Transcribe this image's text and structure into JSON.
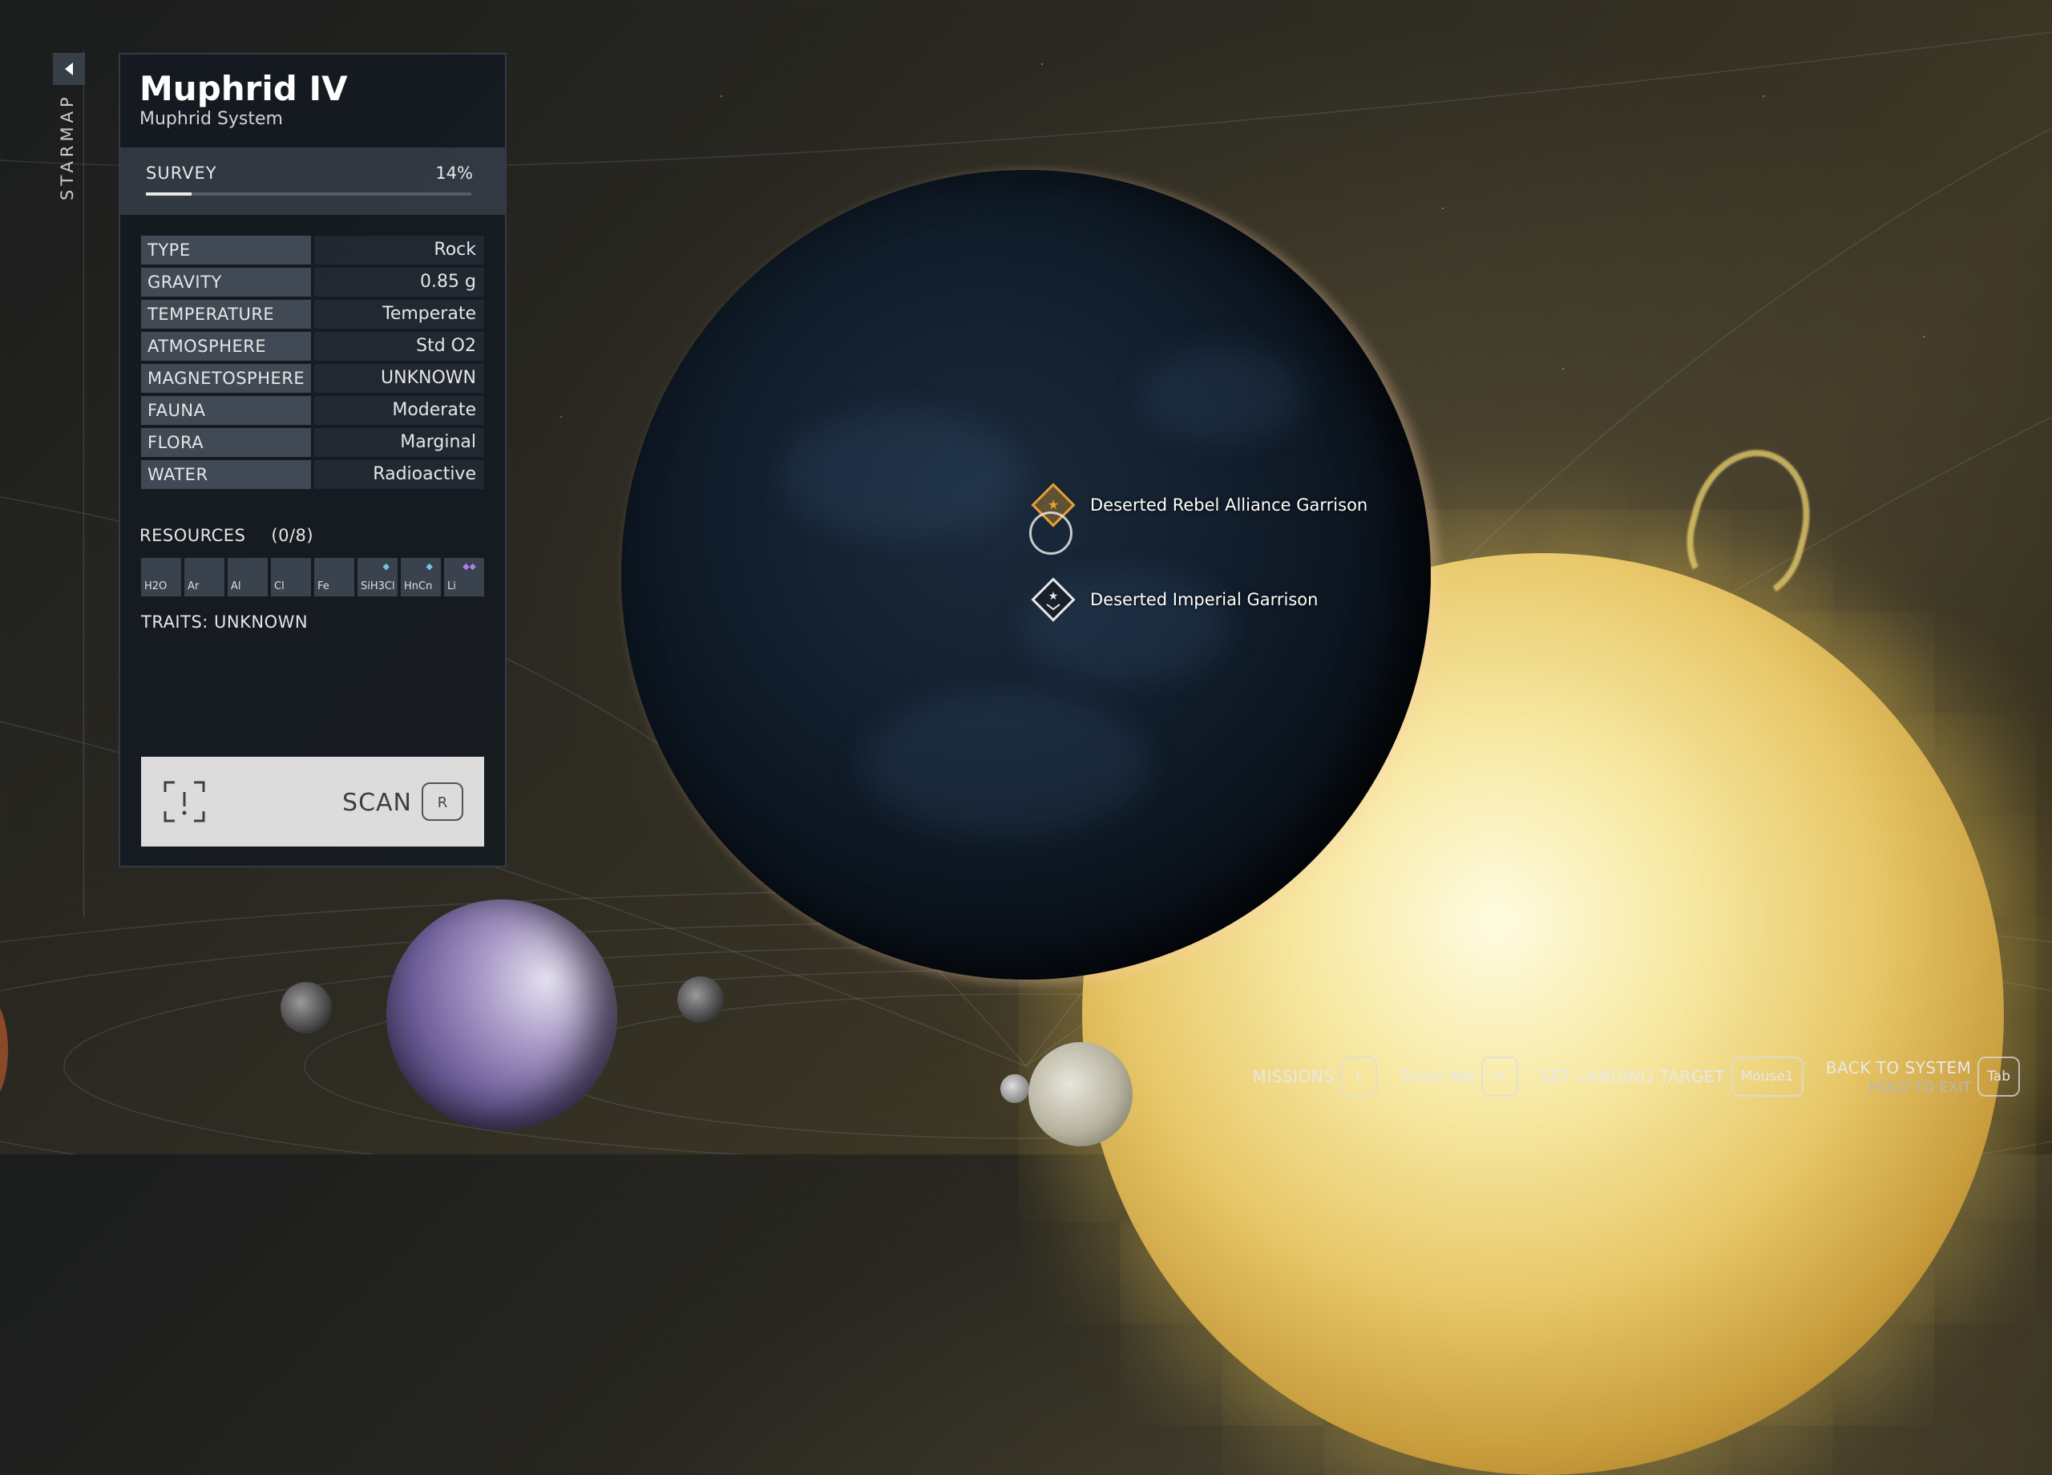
{
  "starmap": {
    "label": "STARMAP"
  },
  "planet": {
    "name": "Muphrid IV",
    "system": "Muphrid System"
  },
  "survey": {
    "label": "SURVEY",
    "percent_text": "14%",
    "progress": 0.14
  },
  "properties": [
    {
      "key": "TYPE",
      "value": "Rock"
    },
    {
      "key": "GRAVITY",
      "value": "0.85 g"
    },
    {
      "key": "TEMPERATURE",
      "value": "Temperate"
    },
    {
      "key": "ATMOSPHERE",
      "value": "Std O2"
    },
    {
      "key": "MAGNETOSPHERE",
      "value": "UNKNOWN"
    },
    {
      "key": "FAUNA",
      "value": "Moderate"
    },
    {
      "key": "FLORA",
      "value": "Marginal"
    },
    {
      "key": "WATER",
      "value": "Radioactive"
    }
  ],
  "resources": {
    "label": "RESOURCES",
    "count": "(0/8)",
    "items": [
      {
        "symbol": "H2O",
        "marker": ""
      },
      {
        "symbol": "Ar",
        "marker": ""
      },
      {
        "symbol": "Al",
        "marker": ""
      },
      {
        "symbol": "Cl",
        "marker": ""
      },
      {
        "symbol": "Fe",
        "marker": ""
      },
      {
        "symbol": "SiH3Cl",
        "marker": "◆",
        "marker_color": "#6ec6e6"
      },
      {
        "symbol": "HnCn",
        "marker": "◆",
        "marker_color": "#6ec6e6"
      },
      {
        "symbol": "Li",
        "marker": "◆◆",
        "marker_color": "#b07ae6"
      }
    ]
  },
  "traits": {
    "label": "TRAITS: UNKNOWN"
  },
  "scan": {
    "label": "SCAN",
    "key": "R",
    "icon": "scan-bracket-icon"
  },
  "pois": [
    {
      "label": "Deserted Rebel Alliance Garrison",
      "color": "#e8a030",
      "icon": "star-diamond-icon"
    },
    {
      "label": "Deserted Imperial Garrison",
      "color": "#e8e8e8",
      "icon": "star-diamond-icon"
    }
  ],
  "hints": {
    "missions": {
      "label": "MISSIONS",
      "key": "L"
    },
    "show_me": {
      "label": "Show Me",
      "key": "V"
    },
    "landing": {
      "label": "SET LANDING TARGET",
      "key": "Mouse1"
    },
    "back": {
      "label": "BACK TO SYSTEM",
      "sub": "HOLD TO EXIT",
      "key": "Tab"
    }
  },
  "colors": {
    "accent_orange": "#e8a030",
    "panel_bg": "#141a22",
    "scan_bg": "#dcdcdc"
  }
}
